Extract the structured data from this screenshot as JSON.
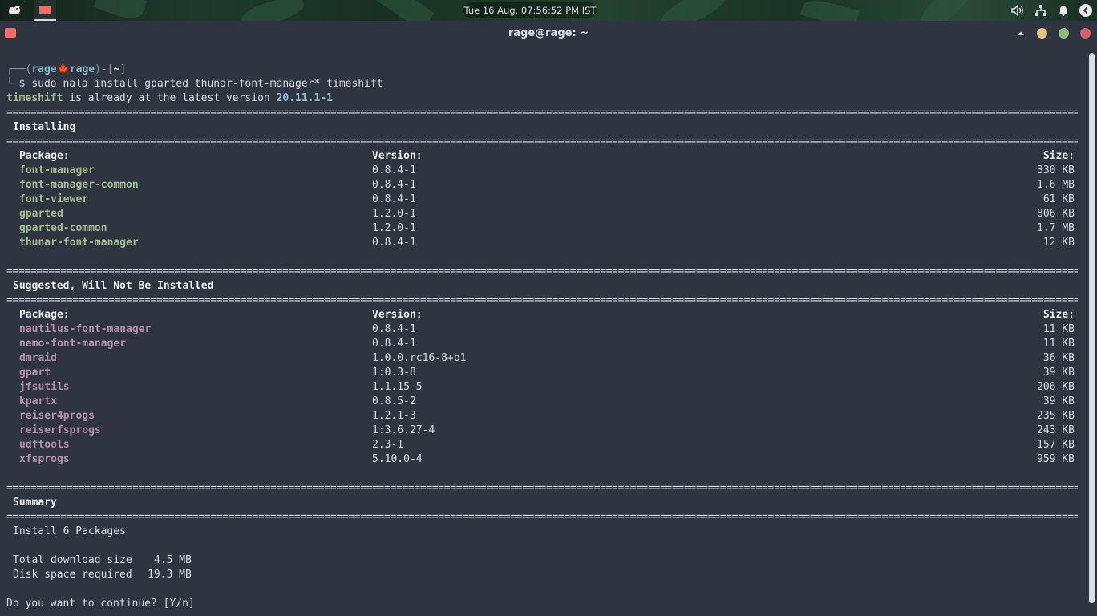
{
  "panel": {
    "clock": "Tue 16 Aug, 07:56:52 PM IST",
    "icons": [
      "whisker-menu-icon",
      "terminal-task-icon",
      "volume-icon",
      "network-icon",
      "bell-icon",
      "prev-workspace-icon"
    ]
  },
  "window": {
    "title": "rage@rage: ~"
  },
  "terminal": {
    "prompt_user": "rage",
    "prompt_host": "rage",
    "prompt_dir": "~",
    "command": "sudo nala install gparted thunar-font-manager* timeshift",
    "msg_pkg": "timeshift",
    "msg_text": " is already at the latest version ",
    "msg_ver": "20.11.1-1",
    "separator": "==========================================================================================================================================================================================",
    "installing": {
      "title": "Installing",
      "col_package": "Package:",
      "col_version": "Version:",
      "col_size": "Size:",
      "rows": [
        {
          "name": "font-manager",
          "version": "0.8.4-1",
          "size": "330 KB"
        },
        {
          "name": "font-manager-common",
          "version": "0.8.4-1",
          "size": "1.6 MB"
        },
        {
          "name": "font-viewer",
          "version": "0.8.4-1",
          "size": "61 KB"
        },
        {
          "name": "gparted",
          "version": "1.2.0-1",
          "size": "806 KB"
        },
        {
          "name": "gparted-common",
          "version": "1.2.0-1",
          "size": "1.7 MB"
        },
        {
          "name": "thunar-font-manager",
          "version": "0.8.4-1",
          "size": "12 KB"
        }
      ]
    },
    "suggested": {
      "title": "Suggested, Will Not Be Installed",
      "col_package": "Package:",
      "col_version": "Version:",
      "col_size": "Size:",
      "rows": [
        {
          "name": "nautilus-font-manager",
          "version": "0.8.4-1",
          "size": "11 KB"
        },
        {
          "name": "nemo-font-manager",
          "version": "0.8.4-1",
          "size": "11 KB"
        },
        {
          "name": "dmraid",
          "version": "1.0.0.rc16-8+b1",
          "size": "36 KB"
        },
        {
          "name": "gpart",
          "version": "1:0.3-8",
          "size": "39 KB"
        },
        {
          "name": "jfsutils",
          "version": "1.1.15-5",
          "size": "206 KB"
        },
        {
          "name": "kpartx",
          "version": "0.8.5-2",
          "size": "39 KB"
        },
        {
          "name": "reiser4progs",
          "version": "1.2.1-3",
          "size": "235 KB"
        },
        {
          "name": "reiserfsprogs",
          "version": "1:3.6.27-4",
          "size": "243 KB"
        },
        {
          "name": "udftools",
          "version": "2.3-1",
          "size": "157 KB"
        },
        {
          "name": "xfsprogs",
          "version": "5.10.0-4",
          "size": "959 KB"
        }
      ]
    },
    "summary": {
      "title": "Summary",
      "install": "Install 6 Packages",
      "download_label": "Total download size",
      "download_value": "4.5 MB",
      "disk_label": "Disk space required",
      "disk_value": "19.3 MB"
    },
    "question": "Do you want to continue? [Y/n]"
  }
}
